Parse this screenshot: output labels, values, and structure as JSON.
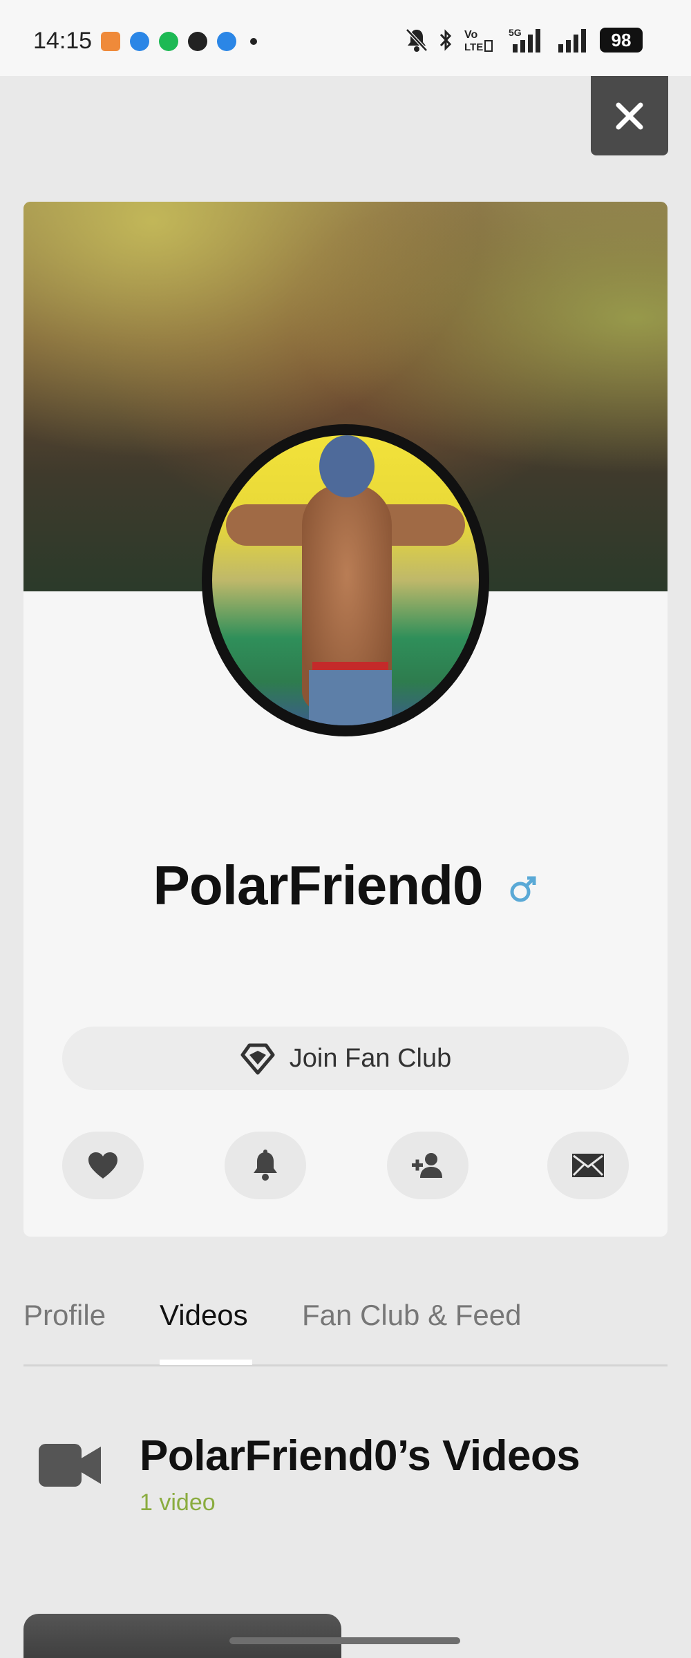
{
  "status_bar": {
    "time": "14:15",
    "battery": "98",
    "icons": [
      "mute-bell-icon",
      "bluetooth-icon",
      "volte-icon",
      "5g-signal-icon",
      "signal-icon",
      "battery-icon"
    ],
    "app_icons": [
      "game-app-icon",
      "browser-app-icon",
      "spotify-app-icon",
      "chat-app-icon",
      "browser-app-icon"
    ]
  },
  "close_button": {
    "icon": "close-icon"
  },
  "profile": {
    "username": "PolarFriend0",
    "gender_icon": "male-symbol-icon",
    "gender_color": "#5aa9d6",
    "join_fan_club": "Join Fan Club",
    "actions": [
      "heart-icon",
      "bell-icon",
      "add-friend-icon",
      "message-icon"
    ]
  },
  "tabs": [
    {
      "label": "Profile",
      "active": false
    },
    {
      "label": "Videos",
      "active": true
    },
    {
      "label": "Fan Club & Feed",
      "active": false
    }
  ],
  "videos": {
    "title": "PolarFriend0’s Videos",
    "count": "1 video",
    "count_color": "#8aac3f"
  }
}
